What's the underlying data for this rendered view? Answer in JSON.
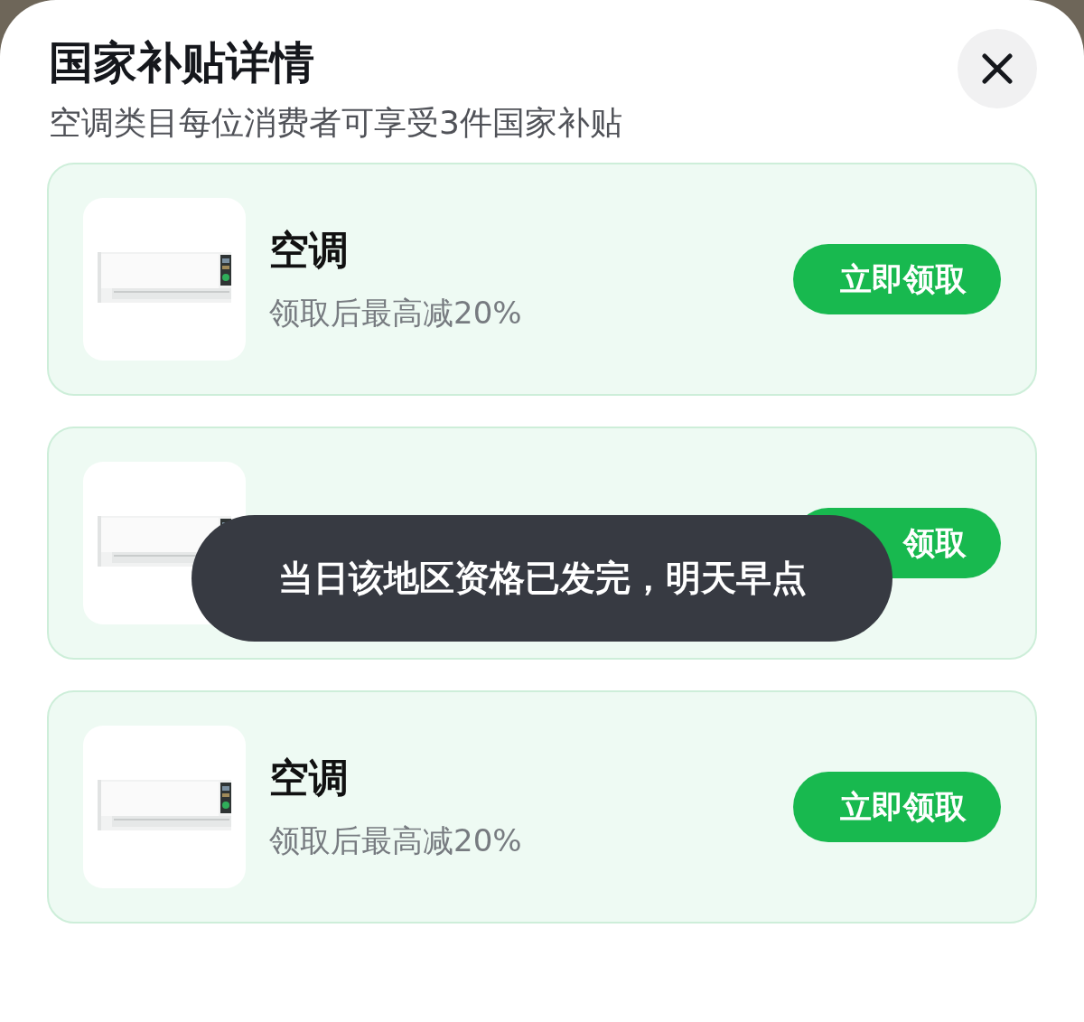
{
  "header": {
    "title": "国家补贴详情",
    "subtitle": "空调类目每位消费者可享受3件国家补贴"
  },
  "cards": [
    {
      "title": "空调",
      "desc": "领取后最高减20%",
      "button": "立即领取"
    },
    {
      "button": "领取"
    },
    {
      "title": "空调",
      "desc": "领取后最高减20%",
      "button": "立即领取"
    }
  ],
  "toast": {
    "text": "当日该地区资格已发完，明天早点"
  }
}
